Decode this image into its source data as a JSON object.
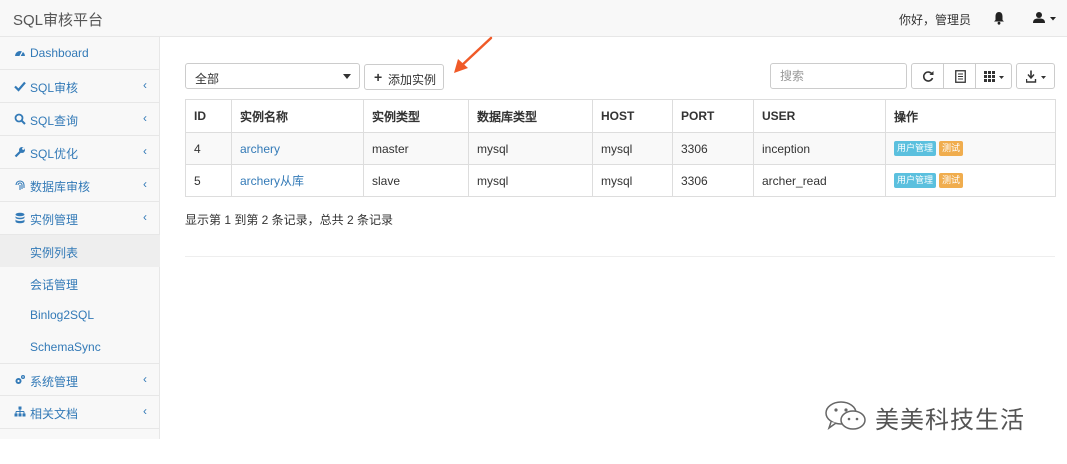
{
  "app": {
    "brand": "SQL审核平台",
    "greeting": "你好，管理员"
  },
  "sidebar": {
    "items": [
      {
        "label": "Dashboard",
        "icon": "dashboard-icon",
        "has_chevron": false
      },
      {
        "label": "SQL审核",
        "icon": "check-icon",
        "has_chevron": true
      },
      {
        "label": "SQL查询",
        "icon": "search-icon",
        "has_chevron": true
      },
      {
        "label": "SQL优化",
        "icon": "wrench-icon",
        "has_chevron": true
      },
      {
        "label": "数据库审核",
        "icon": "fingerprint-icon",
        "has_chevron": true
      },
      {
        "label": "实例管理",
        "icon": "database-icon",
        "has_chevron": true
      },
      {
        "label": "系统管理",
        "icon": "cogs-icon",
        "has_chevron": true
      },
      {
        "label": "相关文档",
        "icon": "sitemap-icon",
        "has_chevron": true
      }
    ],
    "chevron": "‹",
    "subitems": [
      {
        "label": "实例列表",
        "active": true
      },
      {
        "label": "会话管理",
        "active": false
      },
      {
        "label": "Binlog2SQL",
        "active": false
      },
      {
        "label": "SchemaSync",
        "active": false
      }
    ]
  },
  "toolbar": {
    "filter_value": "全部",
    "add_label": "添加实例",
    "search_placeholder": "搜索"
  },
  "table": {
    "columns": [
      "ID",
      "实例名称",
      "实例类型",
      "数据库类型",
      "HOST",
      "PORT",
      "USER",
      "操作"
    ],
    "rows": [
      {
        "id": "4",
        "name": "archery",
        "type": "master",
        "db_type": "mysql",
        "host": "mysql",
        "port": "3306",
        "user": "inception"
      },
      {
        "id": "5",
        "name": "archery从库",
        "type": "slave",
        "db_type": "mysql",
        "host": "mysql",
        "port": "3306",
        "user": "archer_read"
      }
    ],
    "action_user": "用户管理",
    "action_test": "测试"
  },
  "pagination": {
    "summary": "显示第 1 到第 2 条记录，总共 2 条记录"
  },
  "watermark": {
    "text": "美美科技生活"
  },
  "colors": {
    "link": "#337ab7",
    "info_label": "#5bc0de",
    "warning_label": "#f0ad4e",
    "arrow": "#f05a28"
  }
}
